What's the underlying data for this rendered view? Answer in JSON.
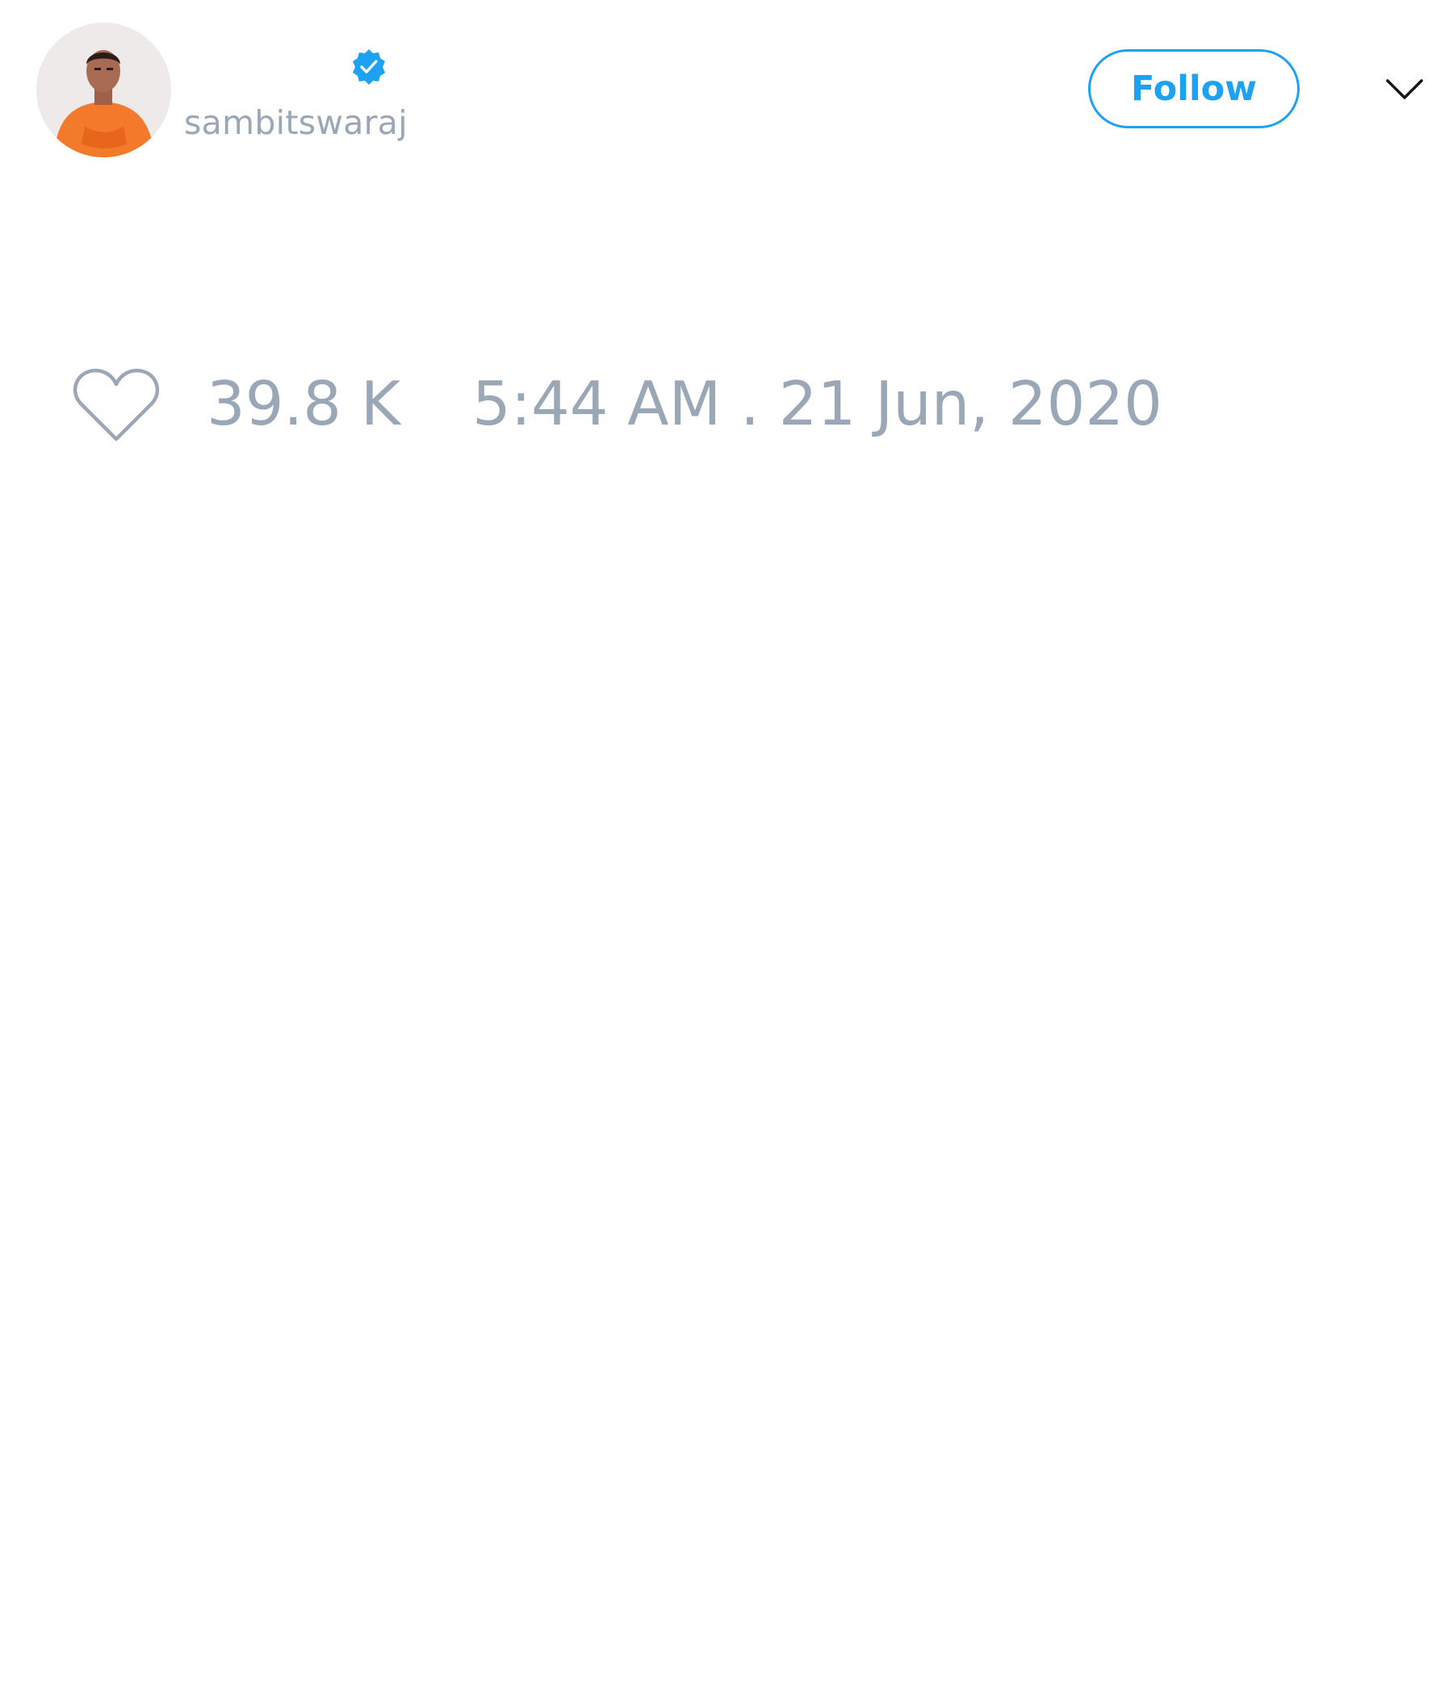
{
  "author": {
    "display_name": "",
    "handle": "sambitswaraj",
    "verified": true,
    "avatar_icon": "person-avatar"
  },
  "header": {
    "follow_label": "Follow",
    "menu_icon": "chevron-down-icon"
  },
  "stats": {
    "like_icon": "heart-outline-icon",
    "like_count": "39.8 K",
    "timestamp": "5:44 AM . 21 Jun, 2020"
  },
  "colors": {
    "accent": "#1da1f2",
    "muted_text": "#9aa7b7",
    "avatar_robe": "#f47a2b"
  }
}
